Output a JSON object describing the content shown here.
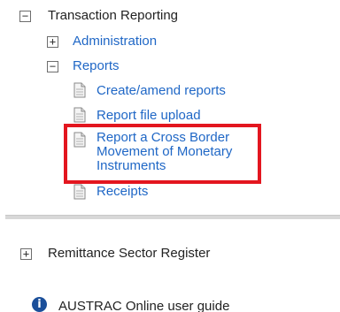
{
  "tree": {
    "transaction_reporting": {
      "label": "Transaction Reporting",
      "toggle": "−"
    },
    "administration": {
      "label": "Administration",
      "toggle": "+"
    },
    "reports": {
      "label": "Reports",
      "toggle": "−"
    },
    "items": [
      {
        "label": "Create/amend reports"
      },
      {
        "label": "Report file upload"
      },
      {
        "label_lines": [
          "Report a Cross Border",
          "Movement of Monetary",
          "Instruments"
        ]
      },
      {
        "label": "Receipts"
      }
    ]
  },
  "remittance": {
    "label": "Remittance Sector Register",
    "toggle": "+"
  },
  "guide": {
    "label": "AUSTRAC Online user guide",
    "icon_glyph": "i"
  },
  "colors": {
    "link": "#1f67c6",
    "highlight_border": "#e3161f",
    "info_icon": "#1b4f9a"
  }
}
